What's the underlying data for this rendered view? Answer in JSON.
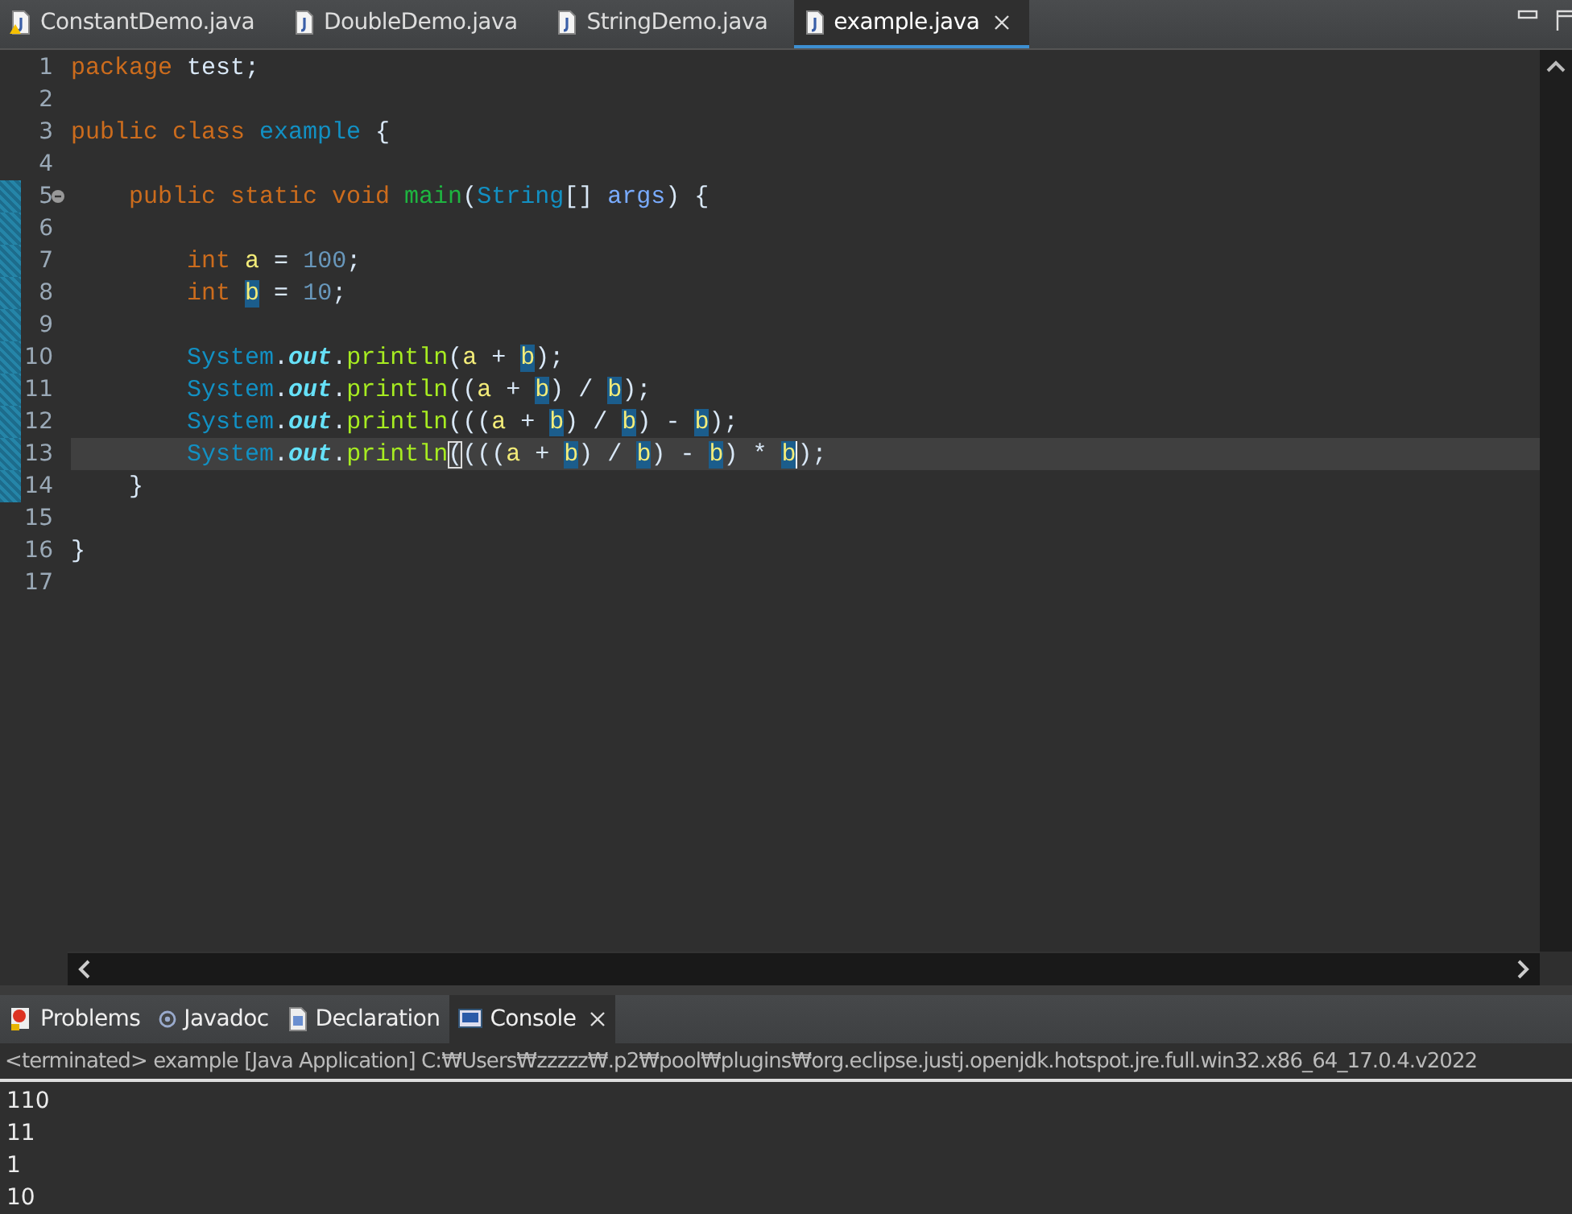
{
  "editor_tabs": [
    {
      "label": "ConstantDemo.java",
      "selected": false,
      "kind": "warning-file"
    },
    {
      "label": "DoubleDemo.java",
      "selected": false,
      "kind": "file"
    },
    {
      "label": "StringDemo.java",
      "selected": false,
      "kind": "file"
    },
    {
      "label": "example.java",
      "selected": true,
      "kind": "file"
    }
  ],
  "code_lines": [
    {
      "number": "1",
      "changed": false,
      "current": false,
      "tokens": [
        {
          "text": "package",
          "kind": "keyword"
        },
        {
          "text": " test;",
          "kind": "plain"
        }
      ]
    },
    {
      "number": "2",
      "changed": false,
      "current": false
    },
    {
      "number": "3",
      "changed": false,
      "current": false,
      "tokens": [
        {
          "text": "public class",
          "kind": "keyword"
        },
        {
          "text": " example",
          "kind": "type"
        },
        {
          "text": " {",
          "kind": "plain"
        }
      ]
    },
    {
      "number": "4",
      "changed": false,
      "current": false
    },
    {
      "number": "5",
      "changed": true,
      "current": false,
      "folding": true,
      "tokens": [
        {
          "text": "    public static void",
          "kind": "keyword"
        },
        {
          "text": " main",
          "kind": "method-declaration"
        },
        {
          "text": "(",
          "kind": "plain"
        },
        {
          "text": "String",
          "kind": "type"
        },
        {
          "text": "[] ",
          "kind": "plain"
        },
        {
          "text": "args",
          "kind": "parameter"
        },
        {
          "text": ") {",
          "kind": "plain"
        }
      ]
    },
    {
      "number": "6",
      "changed": true,
      "current": false
    },
    {
      "number": "7",
      "changed": true,
      "current": false,
      "tokens": [
        {
          "text": "        int ",
          "kind": "keyword"
        },
        {
          "text": "a",
          "kind": "local",
          "highlighted": false
        },
        {
          "text": " = ",
          "kind": "plain"
        },
        {
          "text": "100",
          "kind": "number"
        },
        {
          "text": ";",
          "kind": "plain"
        }
      ]
    },
    {
      "number": "8",
      "changed": true,
      "current": false,
      "tokens": [
        {
          "text": "        int ",
          "kind": "keyword"
        },
        {
          "text": "b",
          "kind": "local",
          "highlighted": true
        },
        {
          "text": " = ",
          "kind": "plain"
        },
        {
          "text": "10",
          "kind": "number"
        },
        {
          "text": ";",
          "kind": "plain"
        }
      ]
    },
    {
      "number": "9",
      "changed": true,
      "current": false
    },
    {
      "number": "10",
      "changed": true,
      "current": false,
      "tokens": [
        {
          "text": "        System",
          "kind": "type"
        },
        {
          "text": ".",
          "kind": "plain"
        },
        {
          "text": "out",
          "kind": "field"
        },
        {
          "text": ".",
          "kind": "plain"
        },
        {
          "text": "println",
          "kind": "method"
        },
        {
          "text": "(",
          "kind": "plain"
        },
        {
          "text": "a",
          "kind": "local",
          "highlighted": false
        },
        {
          "text": " + ",
          "kind": "plain"
        },
        {
          "text": "b",
          "kind": "local",
          "highlighted": true
        },
        {
          "text": ");",
          "kind": "plain"
        }
      ]
    },
    {
      "number": "11",
      "changed": true,
      "current": false,
      "tokens": [
        {
          "text": "        System",
          "kind": "type"
        },
        {
          "text": ".",
          "kind": "plain"
        },
        {
          "text": "out",
          "kind": "field"
        },
        {
          "text": ".",
          "kind": "plain"
        },
        {
          "text": "println",
          "kind": "method"
        },
        {
          "text": "((",
          "kind": "plain"
        },
        {
          "text": "a",
          "kind": "local",
          "highlighted": false
        },
        {
          "text": " + ",
          "kind": "plain"
        },
        {
          "text": "b",
          "kind": "local",
          "highlighted": true
        },
        {
          "text": ") / ",
          "kind": "plain"
        },
        {
          "text": "b",
          "kind": "local",
          "highlighted": true
        },
        {
          "text": ");",
          "kind": "plain"
        }
      ]
    },
    {
      "number": "12",
      "changed": true,
      "current": false,
      "tokens": [
        {
          "text": "        System",
          "kind": "type"
        },
        {
          "text": ".",
          "kind": "plain"
        },
        {
          "text": "out",
          "kind": "field"
        },
        {
          "text": ".",
          "kind": "plain"
        },
        {
          "text": "println",
          "kind": "method"
        },
        {
          "text": "(((",
          "kind": "plain"
        },
        {
          "text": "a",
          "kind": "local",
          "highlighted": false
        },
        {
          "text": " + ",
          "kind": "plain"
        },
        {
          "text": "b",
          "kind": "local",
          "highlighted": true
        },
        {
          "text": ") / ",
          "kind": "plain"
        },
        {
          "text": "b",
          "kind": "local",
          "highlighted": true
        },
        {
          "text": ") - ",
          "kind": "plain"
        },
        {
          "text": "b",
          "kind": "local",
          "highlighted": true
        },
        {
          "text": ");",
          "kind": "plain"
        }
      ]
    },
    {
      "number": "13",
      "changed": true,
      "current": true,
      "tokens": [
        {
          "text": "        System",
          "kind": "type"
        },
        {
          "text": ".",
          "kind": "plain"
        },
        {
          "text": "out",
          "kind": "field"
        },
        {
          "text": ".",
          "kind": "plain"
        },
        {
          "text": "println",
          "kind": "method"
        },
        {
          "text": "(",
          "kind": "bracket-match"
        },
        {
          "text": "(((",
          "kind": "plain"
        },
        {
          "text": "a",
          "kind": "local",
          "highlighted": false
        },
        {
          "text": " + ",
          "kind": "plain"
        },
        {
          "text": "b",
          "kind": "local",
          "highlighted": true
        },
        {
          "text": ") / ",
          "kind": "plain"
        },
        {
          "text": "b",
          "kind": "local",
          "highlighted": true
        },
        {
          "text": ") - ",
          "kind": "plain"
        },
        {
          "text": "b",
          "kind": "local",
          "highlighted": true
        },
        {
          "text": ") * ",
          "kind": "plain"
        },
        {
          "text": "b",
          "kind": "local",
          "highlighted": true,
          "caret": true
        },
        {
          "text": ");",
          "kind": "plain"
        }
      ]
    },
    {
      "number": "14",
      "changed": true,
      "current": false,
      "tokens": [
        {
          "text": "    }",
          "kind": "plain"
        }
      ]
    },
    {
      "number": "15",
      "changed": false,
      "current": false
    },
    {
      "number": "16",
      "changed": false,
      "current": false,
      "tokens": [
        {
          "text": "}",
          "kind": "plain"
        }
      ]
    },
    {
      "number": "17",
      "changed": false,
      "current": false
    }
  ],
  "view_tabs": [
    {
      "label": "Problems",
      "selected": false,
      "kind": "problems"
    },
    {
      "label": "Javadoc",
      "selected": false,
      "kind": "javadoc"
    },
    {
      "label": "Declaration",
      "selected": false,
      "kind": "declaration"
    },
    {
      "label": "Console",
      "selected": true,
      "kind": "console"
    }
  ],
  "console": {
    "header": "<terminated> example [Java Application] C:₩Users₩zzzzz₩.p2₩pool₩plugins₩org.eclipse.justj.openjdk.hotspot.jre.full.win32.x86_64_17.0.4.v2022",
    "output": [
      "110",
      "11",
      "1",
      "10"
    ]
  }
}
